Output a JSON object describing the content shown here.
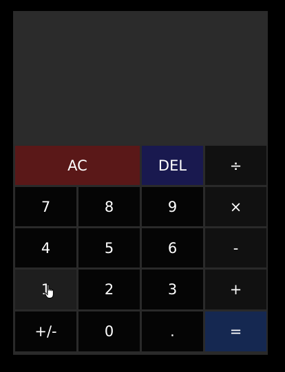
{
  "display": {
    "value": ""
  },
  "keys": {
    "clear": "AC",
    "delete": "DEL",
    "divide": "÷",
    "seven": "7",
    "eight": "8",
    "nine": "9",
    "multiply": "×",
    "four": "4",
    "five": "5",
    "six": "6",
    "subtract": "-",
    "one": "1",
    "two": "2",
    "three": "3",
    "add": "+",
    "negate": "+/-",
    "zero": "0",
    "decimal": ".",
    "equals": "="
  },
  "colors": {
    "background": "#000000",
    "display": "#2b2b2b",
    "digit_key": "#050505",
    "operator_key": "#111111",
    "clear_key": "#5a1818",
    "delete_key": "#19194f",
    "equals_key": "#152851"
  },
  "cursor": {
    "icon": "hand-pointer-icon"
  }
}
